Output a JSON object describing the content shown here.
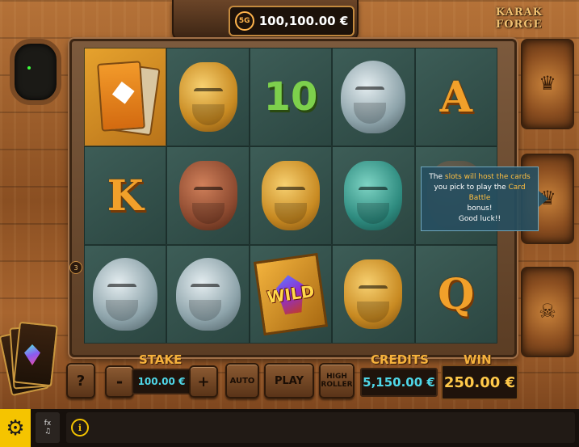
{
  "jackpot": {
    "icon_label": "5G",
    "value": "100,100.00 €"
  },
  "logo_text": "KARAK FORGE",
  "reels": [
    [
      "cardpack",
      "gold-dwarf",
      "10",
      "steel-dwarf",
      "A"
    ],
    [
      "K",
      "copper-dwarf",
      "gold-dwarf",
      "teal-dwarf",
      "hidden"
    ],
    [
      "steel-dwarf",
      "steel-dwarf",
      "wild",
      "gold-dwarf",
      "Q"
    ]
  ],
  "wild_label": "WILD",
  "row_marker": "3",
  "tooltip": {
    "part1": "The ",
    "highlight1": "slots will host the cards",
    "part2": " you pick to play the ",
    "highlight2": "Card Battle",
    "part3": " bonus!",
    "part4": "Good luck!!"
  },
  "controls": {
    "help_label": "?",
    "stake_label": "STAKE",
    "minus_label": "-",
    "stake_value": "100.00 €",
    "plus_label": "+",
    "auto_label": "AUTO",
    "play_label": "PLAY",
    "high_roller_label": "HIGH ROLLER",
    "credits_label": "CREDITS",
    "credits_value": "5,150.00 €",
    "win_label": "WIN",
    "win_value": "250.00 €"
  },
  "footer": {
    "fx_label": "fx",
    "info_label": "i"
  },
  "colors": {
    "accent_orange": "#f6b23c",
    "value_cyan": "#4fd7e8",
    "win_gold": "#ffc94a",
    "menu_yellow": "#f5c400",
    "reel_bg": "#34504b"
  }
}
